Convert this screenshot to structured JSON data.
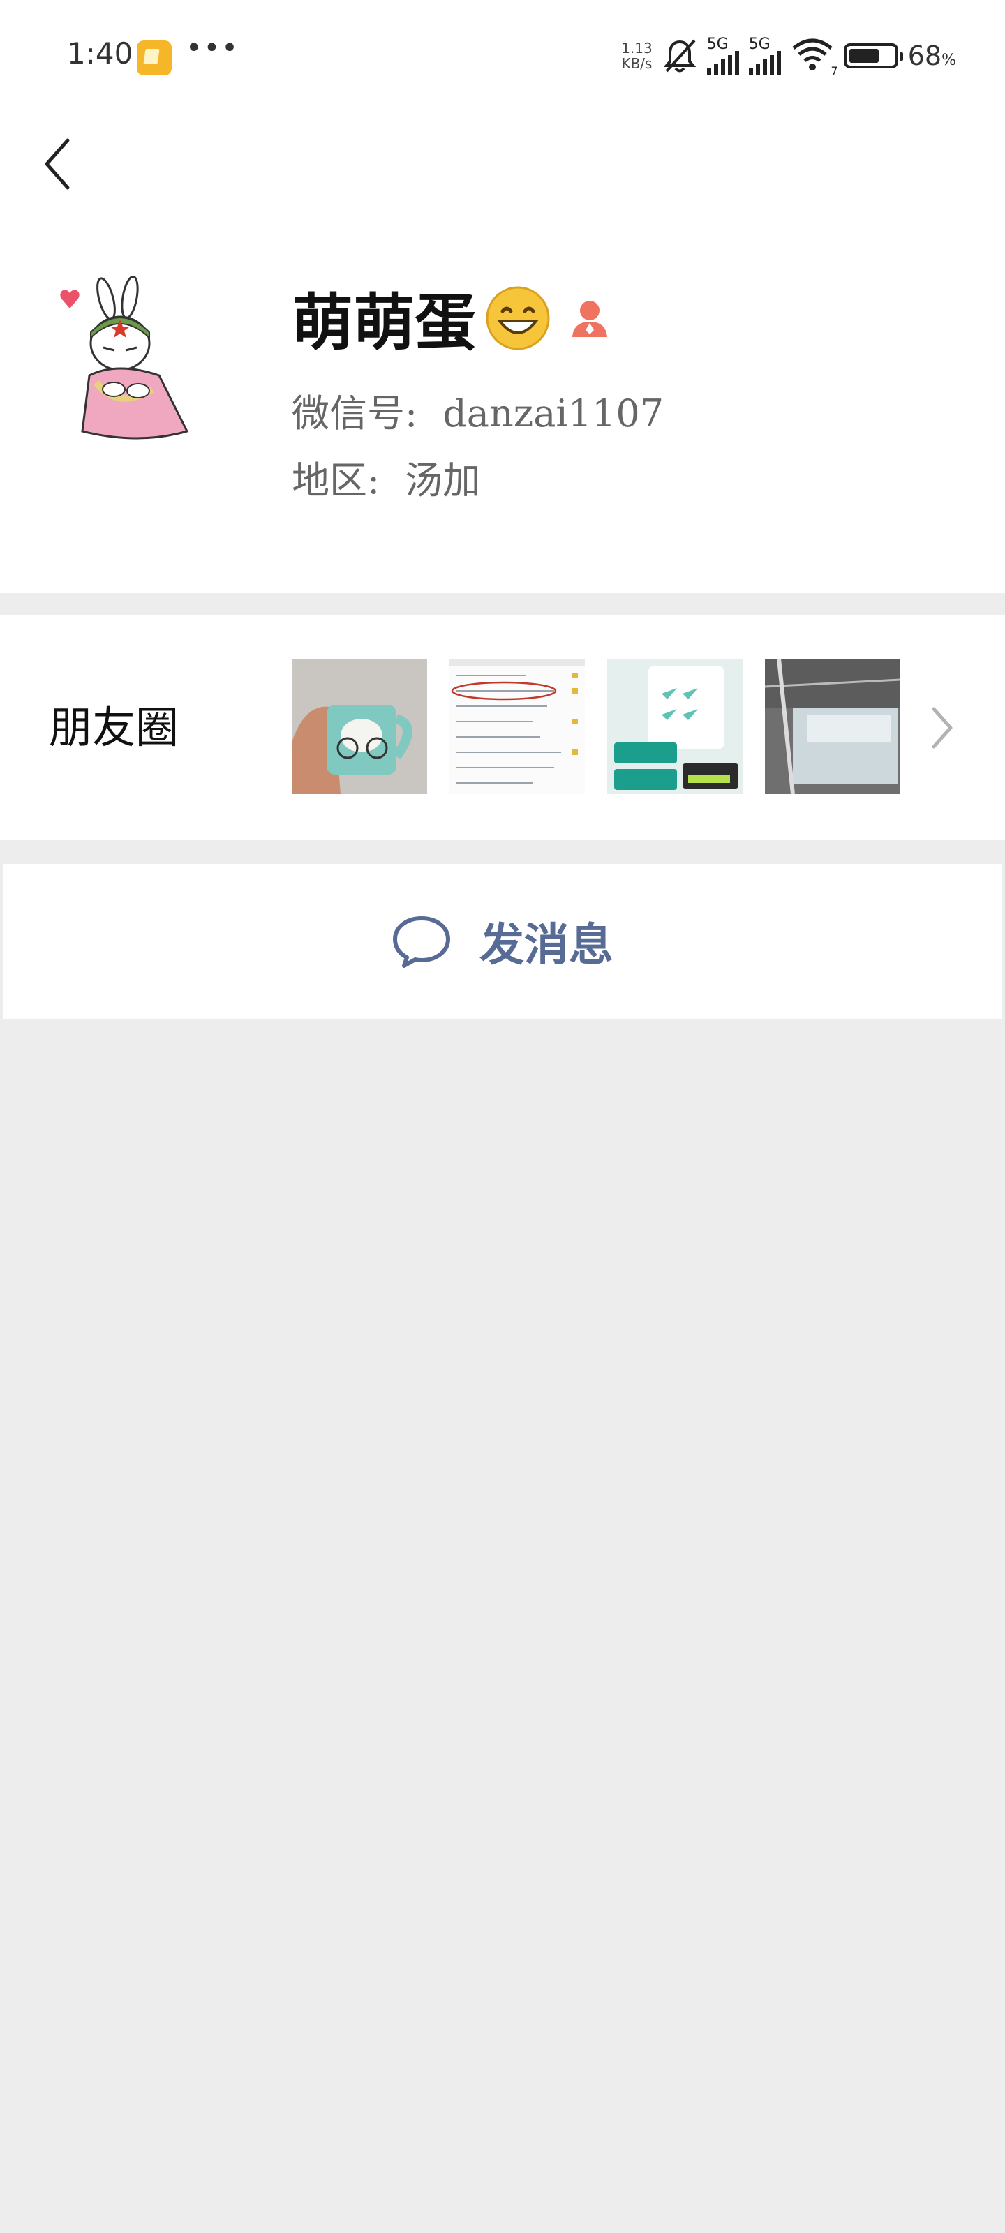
{
  "status_bar": {
    "time": "1:40",
    "more": "•••",
    "speed_value": "1.13",
    "speed_unit": "KB/s",
    "sim1_label": "5G",
    "sim2_label": "5G",
    "wifi_sub": "7",
    "battery_value": "68",
    "battery_unit": "%",
    "battery_level": 0.68,
    "icons": [
      "gallery-app-icon",
      "mute-bell-icon",
      "signal-icon",
      "wifi-icon",
      "battery-icon"
    ]
  },
  "header": {
    "back_icon": "chevron-left-icon"
  },
  "profile": {
    "nickname": "萌萌蛋",
    "gender_icon": "female-icon",
    "wechat_id_label": "微信号:",
    "wechat_id": "danzai1107",
    "region_label": "地区:",
    "region": "汤加"
  },
  "moments": {
    "label": "朋友圈",
    "thumbnails": [
      "mug-photo",
      "list-screenshot",
      "app-screenshot",
      "laptop-photo"
    ]
  },
  "actions": {
    "send_message": "发消息",
    "send_icon": "chat-bubble-icon"
  },
  "colors": {
    "accent": "#576b95",
    "gender_female": "#ef7360",
    "background": "#ededed"
  }
}
